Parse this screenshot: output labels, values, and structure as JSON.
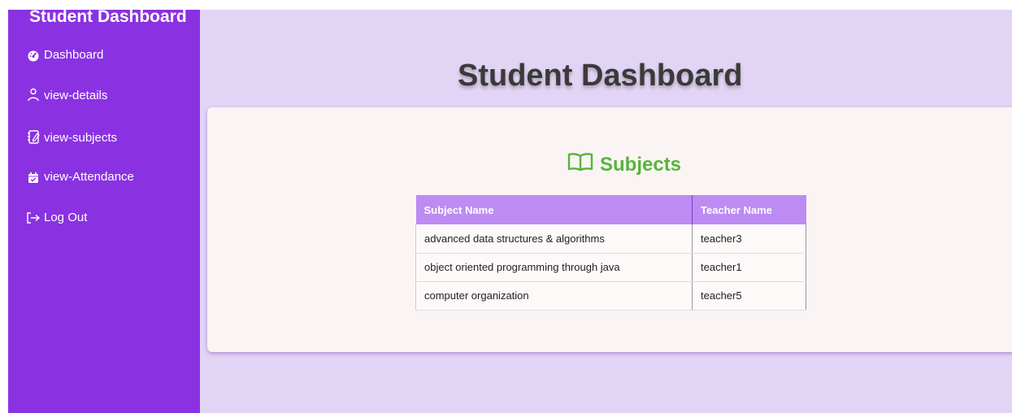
{
  "sidebar": {
    "brand": "Student Dashboard",
    "items": [
      {
        "label": "Dashboard",
        "icon": "dashboard-gauge-icon"
      },
      {
        "label": "view-details",
        "icon": "user-icon"
      },
      {
        "label": "view-subjects",
        "icon": "edit-notebook-icon"
      },
      {
        "label": "view-Attendance",
        "icon": "calendar-check-icon"
      },
      {
        "label": "Log Out",
        "icon": "logout-icon"
      }
    ]
  },
  "main": {
    "title": "Student Dashboard"
  },
  "subjects": {
    "heading": "Subjects",
    "icon": "open-book-icon",
    "columns": [
      "Subject Name",
      "Teacher Name"
    ],
    "rows": [
      {
        "subject": "advanced data structures & algorithms",
        "teacher": "teacher3"
      },
      {
        "subject": "object oriented programming through java",
        "teacher": "teacher1"
      },
      {
        "subject": "computer organization",
        "teacher": "teacher5"
      }
    ]
  },
  "colors": {
    "sidebar": "#8a32e2",
    "background": "#e2d4f4",
    "card": "#fbf4f4",
    "table_header": "#bc8bf3",
    "heading_green": "#56b53a"
  }
}
